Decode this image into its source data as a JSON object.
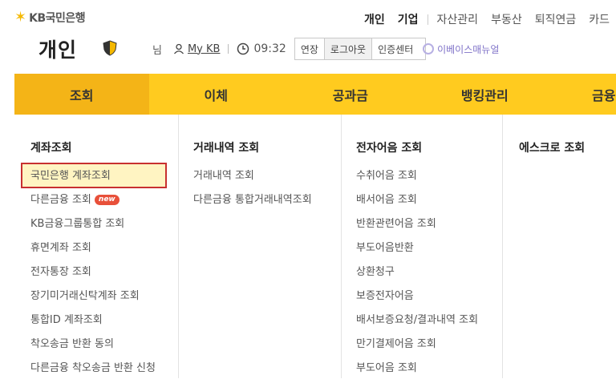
{
  "header": {
    "logo_text": "KB국민은행",
    "page_title": "개인",
    "top_menu": [
      "개인",
      "기업",
      "자산관리",
      "부동산",
      "퇴직연금",
      "카드"
    ],
    "user_suffix": "님",
    "my_kb": "My KB",
    "timer": "09:32",
    "buttons": [
      "연장",
      "로그아웃",
      "인증센터"
    ],
    "watermark": "이베이스매뉴얼"
  },
  "gnb": {
    "tabs": [
      "조회",
      "이체",
      "공과금",
      "뱅킹관리",
      "금융"
    ]
  },
  "menu": {
    "col1": {
      "head": "계좌조회",
      "items": [
        "국민은행 계좌조회",
        "다른금융 조회",
        "KB금융그룹통합 조회",
        "휴면계좌 조회",
        "전자통장 조회",
        "장기미거래신탁계좌 조회",
        "통합ID 계좌조회",
        "착오송금 반환 동의",
        "다른금융 착오송금 반환 신청"
      ],
      "new_badge": "new"
    },
    "col2": {
      "head": "거래내역 조회",
      "items": [
        "거래내역 조회",
        "다른금융 통합거래내역조회"
      ]
    },
    "col3": {
      "head": "전자어음 조회",
      "items": [
        "수취어음 조회",
        "배서어음 조회",
        "반환관련어음 조회",
        "부도어음반환",
        "상환청구",
        "보증전자어음",
        "배서보증요청/결과내역 조회",
        "만기결제어음 조회",
        "부도어음 조회"
      ]
    },
    "col4": {
      "head": "에스크로 조회"
    }
  },
  "colors": {
    "gnb_bg": "#ffcb1f",
    "gnb_active": "#f4b417",
    "highlight_border": "#c83030"
  }
}
